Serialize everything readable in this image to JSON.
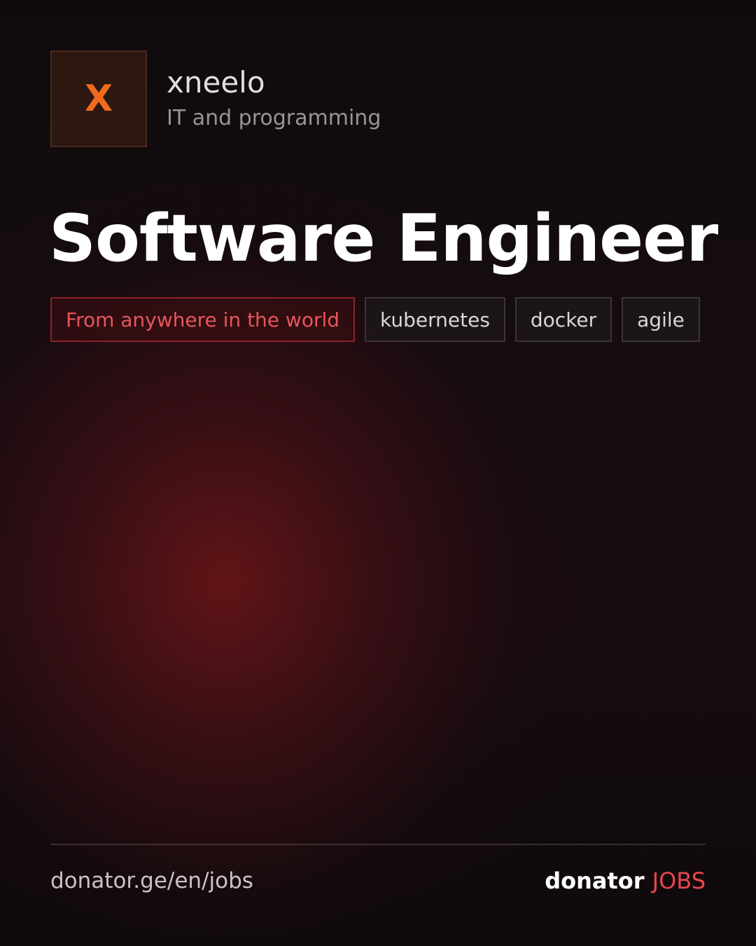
{
  "company": {
    "logo_letter": "X",
    "name": "xneelo",
    "category": "IT and programming"
  },
  "job": {
    "title": "Software Engineer",
    "location": "From anywhere in the world",
    "tags": [
      "kubernetes",
      "docker",
      "agile"
    ]
  },
  "footer": {
    "url": "donator.ge/en/jobs",
    "brand_name": "donator",
    "brand_accent": "JOBS"
  },
  "colors": {
    "logo_letter": "#f26b1d",
    "accent_red": "#e8464b",
    "location_tag_border": "#8e2328",
    "background_glow": "#6e1618"
  }
}
